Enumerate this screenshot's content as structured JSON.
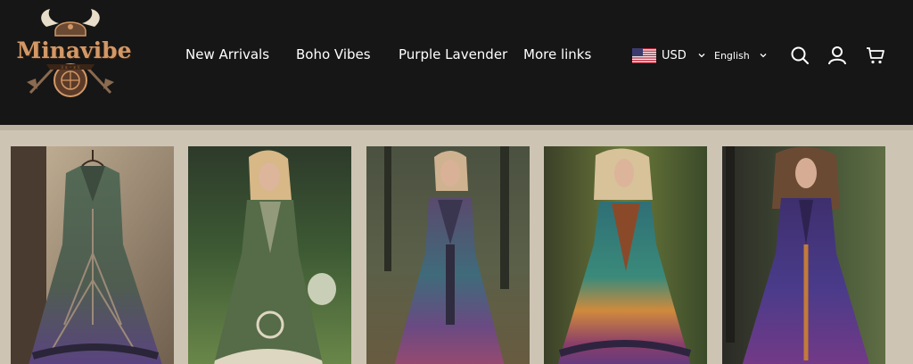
{
  "brand": {
    "name": "Minavibe"
  },
  "nav": {
    "items": [
      {
        "label": "New Arrivals"
      },
      {
        "label": "Boho Vibes"
      },
      {
        "label": "Purple Lavender"
      },
      {
        "label": "More links"
      }
    ]
  },
  "locale": {
    "currency": "USD",
    "currency_flag": "us-flag-icon",
    "language": "English"
  },
  "header_icons": [
    "search-icon",
    "account-icon",
    "cart-icon"
  ],
  "colors": {
    "header_bg": "#161616",
    "page_bg": "#cdc4b4",
    "logo_accent": "#d39866"
  },
  "products": [
    {
      "image": "green purple celtic tree dress on hanger"
    },
    {
      "image": "green celtic embroidered dress in meadow"
    },
    {
      "image": "rainbow tie-dye celtic dress in forest"
    },
    {
      "image": "teal orange purple celtic dress in forest"
    },
    {
      "image": "purple blue pleated celtic dress in forest"
    }
  ]
}
